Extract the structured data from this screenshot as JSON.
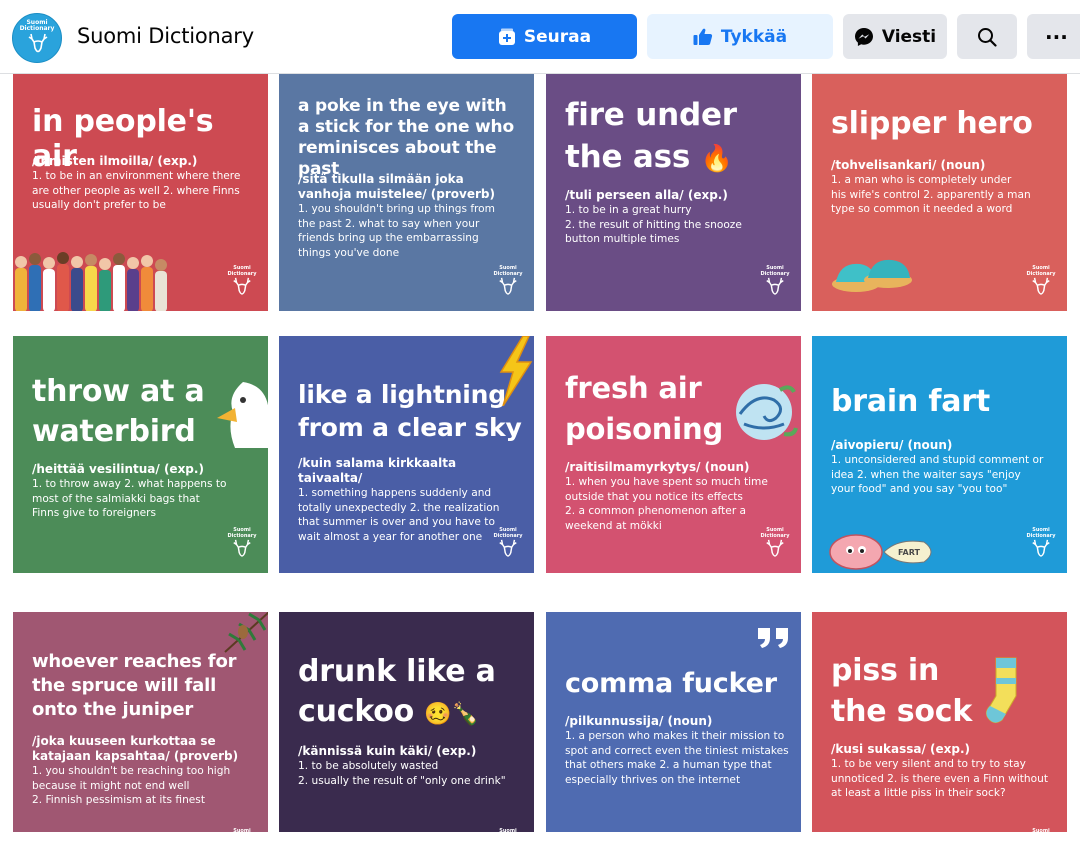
{
  "header": {
    "page_name": "Suomi Dictionary",
    "logo_text_1": "Suomi",
    "logo_text_2": "Dictionary",
    "follow_label": "Seuraa",
    "like_label": "Tykkää",
    "message_label": "Viesti",
    "more_label": "···",
    "colors": {
      "primary": "#1877f2",
      "like_bg": "#e7f3ff",
      "neutral_bg": "#e4e6eb"
    }
  },
  "brand": {
    "line1": "Suomi",
    "line2": "Dictionary"
  },
  "cards": [
    {
      "word_lines": [
        "in people's air"
      ],
      "finnish": "/ihmisten ilmoilla/ (exp.)",
      "definition": [
        "1. to be in an environment where there",
        "are other people as well 2. where Finns",
        "usually don't prefer to be"
      ],
      "color": "#cd4a52",
      "illustration": "crowd-of-people"
    },
    {
      "word_lines": [
        "a poke in the eye with",
        "a stick for the one who",
        "reminisces about the past"
      ],
      "finnish": "/sitä tikulla silmään joka vanhoja muistelee/ (proverb)",
      "finnish_lines": [
        "/sitä tikulla silmään joka",
        "vanhoja muistelee/ (proverb)"
      ],
      "definition": [
        "1. you shouldn't bring up things from",
        "the past 2. what to say when your",
        "friends bring up the embarrassing",
        "things you've done"
      ],
      "color": "#5a77a3"
    },
    {
      "word_lines": [
        "fire under",
        "the ass"
      ],
      "emoji": "🔥",
      "finnish": "/tuli perseen alla/ (exp.)",
      "definition": [
        "1. to be in a great hurry",
        "2. the result of hitting the snooze",
        "button multiple times"
      ],
      "color": "#6a4d85"
    },
    {
      "word_lines": [
        "slipper hero"
      ],
      "finnish": "/tohvelisankari/ (noun)",
      "definition": [
        "1. a man who is completely under",
        "his wife's control 2. apparently a man",
        "type so common it needed a word"
      ],
      "color": "#d9605c",
      "illustration": "slippers"
    },
    {
      "word_lines": [
        "throw at a",
        "waterbird"
      ],
      "finnish": "/heittää vesilintua/ (exp.)",
      "definition": [
        "1. to throw away 2. what happens to",
        "most of the salmiakki bags that",
        "Finns give to foreigners"
      ],
      "color": "#4c8c58",
      "illustration": "duck"
    },
    {
      "word_lines": [
        "like a lightning",
        "from a clear sky"
      ],
      "finnish": "/kuin salama kirkkaalta taivaalta/",
      "definition": [
        "1. something happens suddenly and",
        "totally unexpectedly 2. the realization",
        "that summer is over and you have to",
        "wait almost a year for another one"
      ],
      "color": "#4a5ea6",
      "illustration": "lightning"
    },
    {
      "word_lines": [
        "fresh air",
        "poisoning"
      ],
      "finnish": "/raitisilmamyrkytys/ (noun)",
      "definition": [
        "1. when you have spent so much time",
        "outside that you notice its effects",
        "2. a common phenomenon after a",
        "weekend at mökki"
      ],
      "color": "#d35270",
      "illustration": "wind"
    },
    {
      "word_lines": [
        "brain fart"
      ],
      "finnish": "/aivopieru/ (noun)",
      "definition": [
        "1. unconsidered and stupid comment or",
        "idea 2. when the waiter says \"enjoy",
        "your food\" and you say \"you too\""
      ],
      "color": "#1f9bd8",
      "illustration": "brain",
      "fart_text": "FART"
    },
    {
      "word_lines": [
        "whoever reaches for",
        "the spruce will fall",
        "onto the juniper"
      ],
      "finnish_lines": [
        "/joka kuuseen kurkottaa se",
        "katajaan kapsahtaa/ (proverb)"
      ],
      "finnish": "/joka kuuseen kurkottaa se katajaan kapsahtaa/ (proverb)",
      "definition": [
        "1. you shouldn't be reaching too high",
        "because it might not end well",
        "2. Finnish pessimism at its finest"
      ],
      "color": "#a05772",
      "illustration": "spruce-branch"
    },
    {
      "word_lines": [
        "drunk like a",
        "cuckoo"
      ],
      "emoji": "🥴🍾",
      "finnish": "/kännissä kuin käki/ (exp.)",
      "definition": [
        "1. to be absolutely wasted",
        "2. usually the result of \"only one drink\""
      ],
      "color": "#3a2b4e"
    },
    {
      "word_lines": [
        "comma fucker"
      ],
      "finnish": "/pilkunnussija/ (noun)",
      "definition": [
        "1. a person who makes it their mission to",
        "spot and correct even the tiniest mistakes",
        "that others make 2. a human type that",
        "especially thrives on the internet"
      ],
      "color": "#4f6bb1",
      "illustration": "quote-mark"
    },
    {
      "word_lines": [
        "piss in",
        "the sock"
      ],
      "finnish": "/kusi sukassa/ (exp.)",
      "definition": [
        "1. to be very silent and to try to stay",
        "unnoticed 2. is there even a Finn without",
        "at least a little piss in their sock?"
      ],
      "color": "#d3545b",
      "illustration": "sock"
    }
  ]
}
